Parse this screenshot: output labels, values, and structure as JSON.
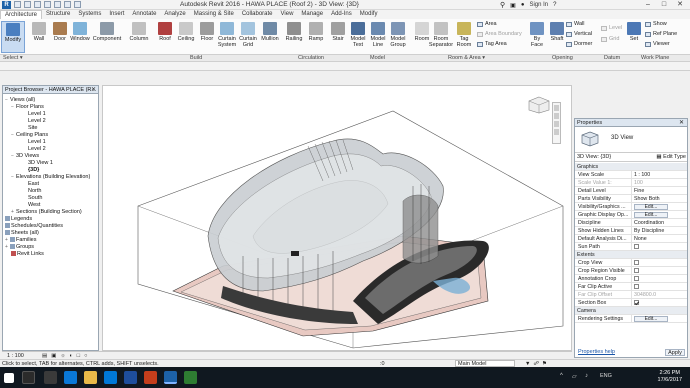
{
  "window": {
    "title": "Autodesk Revit 2016 -    HAWA PLACE (Roof 2) - 3D View: {3D}",
    "sign_in": "Sign In",
    "minimize": "–",
    "maximize": "□",
    "close": "✕",
    "search_placeholder": ""
  },
  "ribbon_tabs": [
    "Architecture",
    "Structure",
    "Systems",
    "Insert",
    "Annotate",
    "Analyze",
    "Massing & Site",
    "Collaborate",
    "View",
    "Manage",
    "Add-Ins",
    "Modify"
  ],
  "tools": {
    "modify": "Modify",
    "wall": "Wall",
    "door": "Door",
    "window": "Window",
    "component": "Component",
    "column": "Column",
    "roof": "Roof",
    "ceiling": "Ceiling",
    "floor": "Floor",
    "curtain_system": "Curtain System",
    "curtain_grid": "Curtain Grid",
    "mullion": "Mullion",
    "railing": "Railing",
    "ramp": "Ramp",
    "stair": "Stair",
    "model_text": "Model Text",
    "model_line": "Model Line",
    "model_group": "Model Group",
    "room": "Room",
    "room_separator": "Room Separator",
    "tag_room": "Tag Room",
    "area": "Area",
    "area_boundary": "Area Boundary",
    "tag_area": "Tag Area",
    "by_face": "By Face",
    "shaft": "Shaft",
    "opening_wall": "Wall",
    "vertical": "Vertical",
    "dormer": "Dormer",
    "level": "Level",
    "grid": "Grid",
    "set": "Set",
    "show": "Show",
    "ref_plane": "Ref Plane",
    "viewer": "Viewer"
  },
  "panels": {
    "select": "Select ▾",
    "build": "Build",
    "circulation": "Circulation",
    "model": "Model",
    "room_area": "Room & Area ▾",
    "opening": "Opening",
    "datum": "Datum",
    "work_plane": "Work Plane"
  },
  "project_browser": {
    "title": "Project Browser - HAWA PLACE (R...",
    "close": "✕",
    "items": [
      {
        "label": "Views (all)",
        "toggle": "−"
      },
      {
        "label": "Floor Plans",
        "toggle": "−"
      },
      {
        "label": "Level 1",
        "toggle": ""
      },
      {
        "label": "Level 2",
        "toggle": ""
      },
      {
        "label": "Site",
        "toggle": ""
      },
      {
        "label": "Ceiling Plans",
        "toggle": "−"
      },
      {
        "label": "Level 1",
        "toggle": ""
      },
      {
        "label": "Level 2",
        "toggle": ""
      },
      {
        "label": "3D Views",
        "toggle": "−"
      },
      {
        "label": "3D View 1",
        "toggle": ""
      },
      {
        "label": "{3D}",
        "toggle": ""
      },
      {
        "label": "Elevations (Building Elevation)",
        "toggle": "−"
      },
      {
        "label": "East",
        "toggle": ""
      },
      {
        "label": "North",
        "toggle": ""
      },
      {
        "label": "South",
        "toggle": ""
      },
      {
        "label": "West",
        "toggle": ""
      },
      {
        "label": "Sections (Building Section)",
        "toggle": "+"
      },
      {
        "label": "Legends",
        "toggle": ""
      },
      {
        "label": "Schedules/Quantities",
        "toggle": ""
      },
      {
        "label": "Sheets (all)",
        "toggle": ""
      },
      {
        "label": "Families",
        "toggle": "+"
      },
      {
        "label": "Groups",
        "toggle": "+"
      },
      {
        "label": "Revit Links",
        "toggle": ""
      }
    ]
  },
  "properties": {
    "title": "Properties",
    "close": "✕",
    "type_name": "3D View",
    "instance": "3D View: {3D}",
    "edit_type": "Edit Type",
    "rows": [
      {
        "key": "Graphics",
        "value": "",
        "kind": "group"
      },
      {
        "key": "View Scale",
        "value": "1 : 100",
        "kind": "field"
      },
      {
        "key": "Scale Value    1:",
        "value": "100",
        "kind": "disabled"
      },
      {
        "key": "Detail Level",
        "value": "Fine",
        "kind": "field"
      },
      {
        "key": "Parts Visibility",
        "value": "Show Both",
        "kind": "field"
      },
      {
        "key": "Visibility/Graphics ...",
        "value": "Edit...",
        "kind": "button"
      },
      {
        "key": "Graphic Display Op...",
        "value": "Edit...",
        "kind": "button"
      },
      {
        "key": "Discipline",
        "value": "Coordination",
        "kind": "field"
      },
      {
        "key": "Show Hidden Lines",
        "value": "By Discipline",
        "kind": "field"
      },
      {
        "key": "Default Analysis Di...",
        "value": "None",
        "kind": "field"
      },
      {
        "key": "Sun Path",
        "value": "off",
        "kind": "check"
      },
      {
        "key": "Extents",
        "value": "",
        "kind": "group"
      },
      {
        "key": "Crop View",
        "value": "off",
        "kind": "check"
      },
      {
        "key": "Crop Region Visible",
        "value": "off",
        "kind": "check"
      },
      {
        "key": "Annotation Crop",
        "value": "off",
        "kind": "check"
      },
      {
        "key": "Far Clip Active",
        "value": "off",
        "kind": "check"
      },
      {
        "key": "Far Clip Offset",
        "value": "304800.0",
        "kind": "disabled"
      },
      {
        "key": "Section Box",
        "value": "on",
        "kind": "check"
      },
      {
        "key": "Camera",
        "value": "",
        "kind": "group"
      },
      {
        "key": "Rendering Settings",
        "value": "Edit...",
        "kind": "button"
      }
    ],
    "help": "Properties help",
    "apply": "Apply"
  },
  "view_control": {
    "scale": "1 : 100"
  },
  "status": {
    "hint": "Click to select, TAB for alternates, CTRL adds, SHIFT unselects.",
    "model": "Main Model",
    "zero": ":0"
  },
  "taskbar": {
    "time": "2:26 PM",
    "date": "17/6/2017",
    "lang": "ENG"
  }
}
